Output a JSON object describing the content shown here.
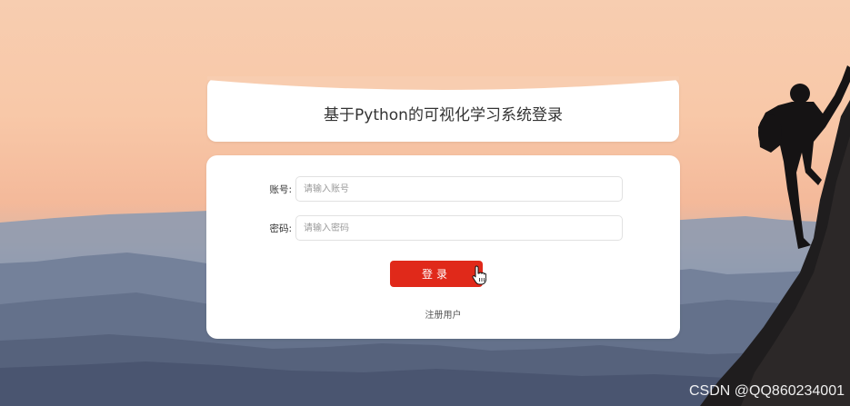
{
  "title": "基于Python的可视化学习系统登录",
  "form": {
    "username_label": "账号:",
    "username_placeholder": "请输入账号",
    "username_value": "",
    "password_label": "密码:",
    "password_placeholder": "请输入密码",
    "password_value": "",
    "login_label": "登录",
    "register_label": "注册用户"
  },
  "watermark": "CSDN @QQ860234001",
  "colors": {
    "accent": "#e0291a",
    "card": "#ffffff"
  },
  "icons": {
    "cursor": "hand-pointer-icon"
  }
}
